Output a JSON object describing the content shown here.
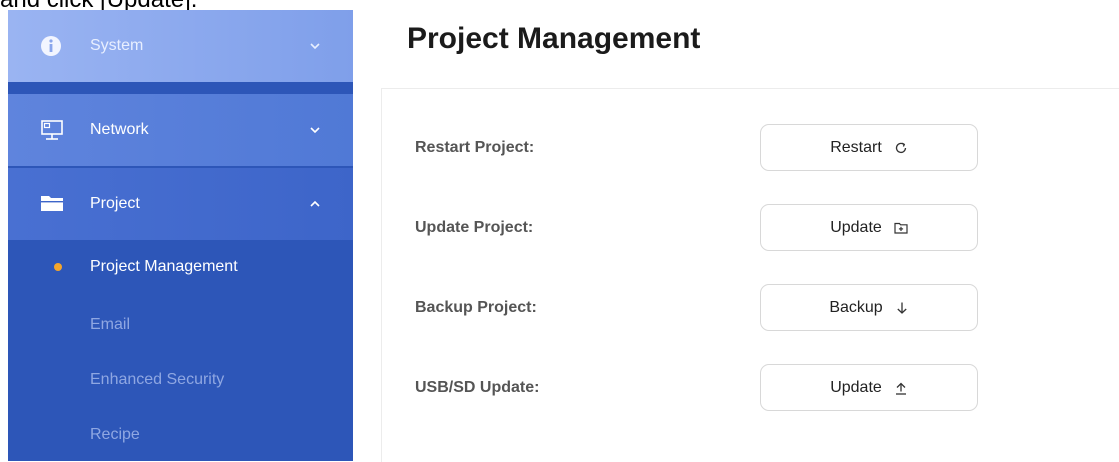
{
  "caption": "and click [Update].",
  "sidebar": {
    "items": [
      {
        "label": "System",
        "icon": "info-icon",
        "expanded": false
      },
      {
        "label": "Network",
        "icon": "network-icon",
        "expanded": false
      },
      {
        "label": "Project",
        "icon": "folder-icon",
        "expanded": true
      }
    ],
    "sub_items": [
      {
        "label": "Project Management",
        "active": true
      },
      {
        "label": "Email",
        "active": false
      },
      {
        "label": "Enhanced Security",
        "active": false
      },
      {
        "label": "Recipe",
        "active": false
      }
    ]
  },
  "page": {
    "title": "Project Management",
    "rows": [
      {
        "label": "Restart Project:",
        "button": "Restart",
        "icon": "refresh-icon"
      },
      {
        "label": "Update Project:",
        "button": "Update",
        "icon": "folder-plus-icon"
      },
      {
        "label": "Backup Project:",
        "button": "Backup",
        "icon": "arrow-down-icon"
      },
      {
        "label": "USB/SD Update:",
        "button": "Update",
        "icon": "upload-icon"
      }
    ]
  },
  "colors": {
    "sidebar": "#2d56b8",
    "active_dot": "#f4a52c"
  }
}
